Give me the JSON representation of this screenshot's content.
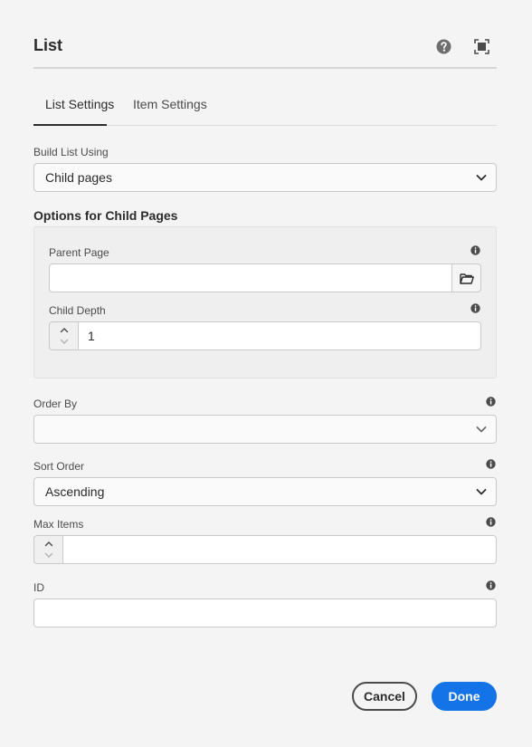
{
  "dialog": {
    "title": "List"
  },
  "tabs": [
    {
      "label": "List Settings",
      "active": true
    },
    {
      "label": "Item Settings",
      "active": false
    }
  ],
  "build_list": {
    "label": "Build List Using",
    "value": "Child pages"
  },
  "child_options": {
    "title": "Options for Child Pages",
    "parent_page": {
      "label": "Parent Page",
      "value": ""
    },
    "child_depth": {
      "label": "Child Depth",
      "value": "1"
    }
  },
  "order_by": {
    "label": "Order By",
    "value": ""
  },
  "sort_order": {
    "label": "Sort Order",
    "value": "Ascending"
  },
  "max_items": {
    "label": "Max Items",
    "value": ""
  },
  "id_field": {
    "label": "ID",
    "value": ""
  },
  "footer": {
    "cancel_label": "Cancel",
    "done_label": "Done"
  },
  "colors": {
    "primary": "#1473e6",
    "background": "#f4f4f4"
  }
}
